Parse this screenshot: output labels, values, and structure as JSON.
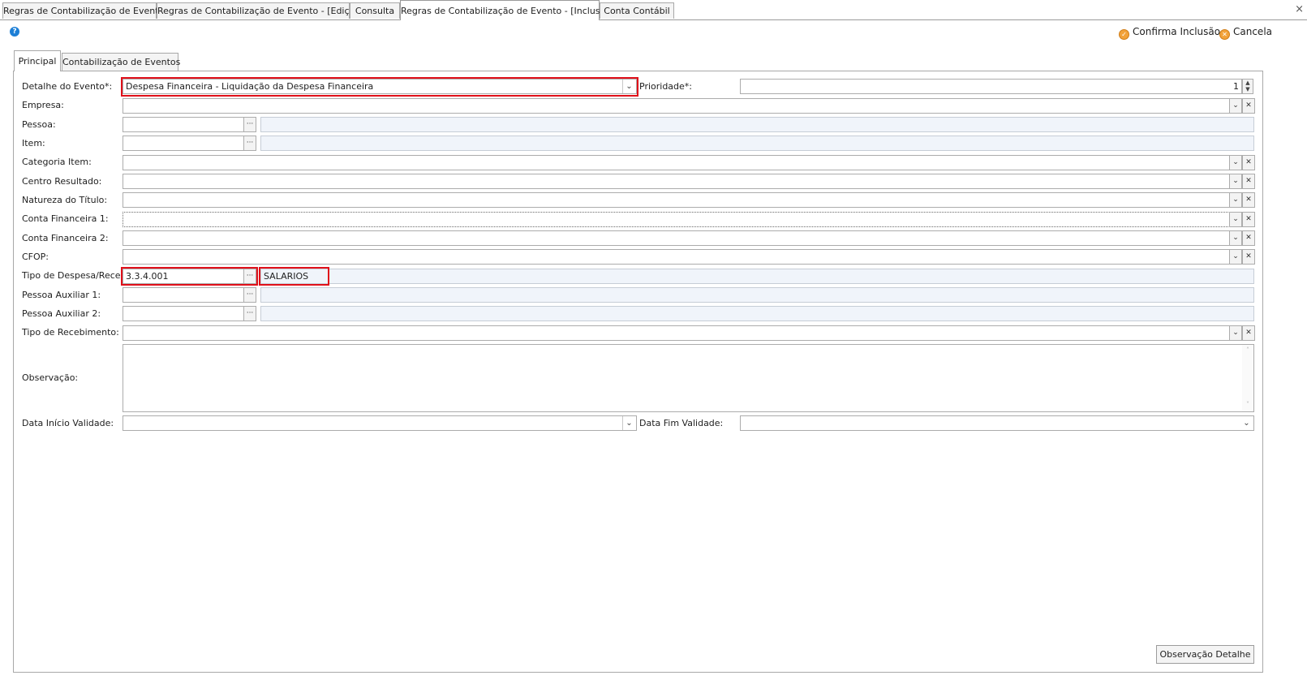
{
  "top_tabs": [
    {
      "label": "Regras de Contabilização de Evento"
    },
    {
      "label": "Regras de Contabilização de Evento - [Edição]"
    },
    {
      "label": "Consulta"
    },
    {
      "label": "Regras de Contabilização de Evento - [Inclusão]"
    },
    {
      "label": "Conta Contábil"
    }
  ],
  "window": {
    "close_glyph": "×"
  },
  "toolbar": {
    "help_glyph": "?",
    "confirm_label": "Confirma Inclusão",
    "cancel_label": "Cancela"
  },
  "inner_tabs": [
    {
      "label": "Principal"
    },
    {
      "label": "Contabilização de Eventos"
    }
  ],
  "form": {
    "detalhe_evento": {
      "label": "Detalhe do Evento*:",
      "value": "Despesa Financeira - Liquidação da Despesa Financeira"
    },
    "prioridade": {
      "label": "Prioridade*:",
      "value": "1"
    },
    "empresa": {
      "label": "Empresa:",
      "value": ""
    },
    "pessoa": {
      "label": "Pessoa:",
      "code": "",
      "description": ""
    },
    "item": {
      "label": "Item:",
      "code": "",
      "description": ""
    },
    "categoria_item": {
      "label": "Categoria Item:",
      "value": ""
    },
    "centro_resultado": {
      "label": "Centro Resultado:",
      "value": ""
    },
    "natureza_titulo": {
      "label": "Natureza do Título:",
      "value": ""
    },
    "conta_financeira_1": {
      "label": "Conta Financeira 1:",
      "value": ""
    },
    "conta_financeira_2": {
      "label": "Conta Financeira 2:",
      "value": ""
    },
    "cfop": {
      "label": "CFOP:",
      "value": ""
    },
    "tipo_despesa_receita": {
      "label": "Tipo de Despesa/Receita:",
      "code": "3.3.4.001",
      "description": "SALARIOS"
    },
    "pessoa_auxiliar_1": {
      "label": "Pessoa Auxiliar 1:",
      "code": "",
      "description": ""
    },
    "pessoa_auxiliar_2": {
      "label": "Pessoa Auxiliar 2:",
      "code": "",
      "description": ""
    },
    "tipo_recebimento": {
      "label": "Tipo de Recebimento:",
      "value": ""
    },
    "observacao": {
      "label": "Observação:",
      "value": ""
    },
    "data_inicio_validade": {
      "label": "Data Início Validade:",
      "value": ""
    },
    "data_fim_validade": {
      "label": "Data Fim Validade:",
      "value": ""
    }
  },
  "footer": {
    "observacao_detalhe_label": "Observação Detalhe"
  },
  "icons": {
    "help": "question-circle-icon",
    "confirm": "check-circle-icon",
    "cancel": "cancel-circle-icon",
    "dropdown": "chevron-down-icon",
    "clear": "clear-x-icon",
    "lookup": "ellipsis-icon"
  },
  "colors": {
    "highlight": "#e0101a",
    "help_icon": "#1d7fd6",
    "action_icon": "#f2a23a",
    "readonly_field": "#f0f4fa"
  }
}
